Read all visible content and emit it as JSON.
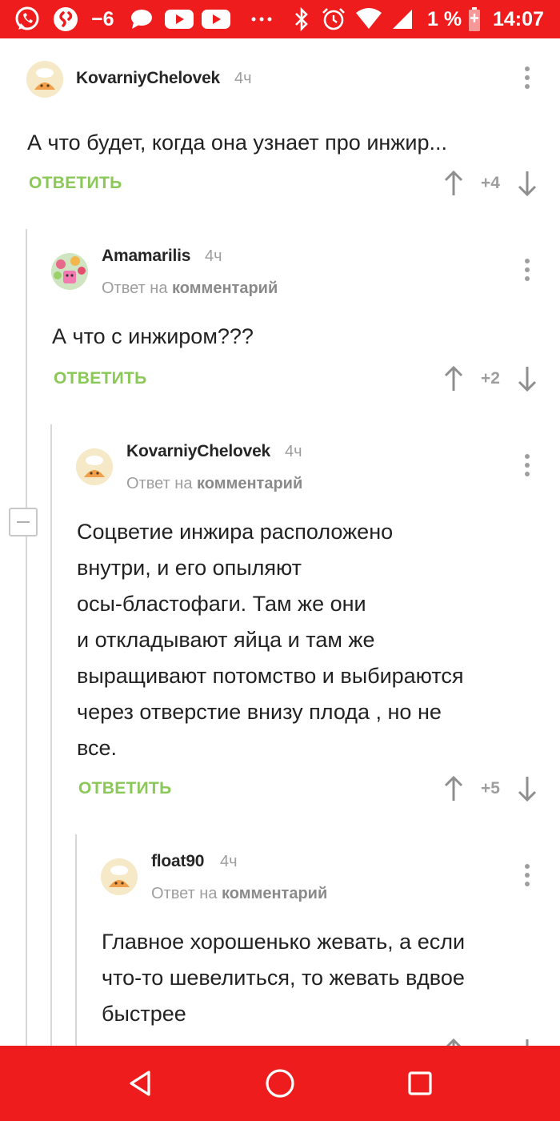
{
  "status_bar": {
    "temperature": "−6",
    "battery": "1 %",
    "time": "14:07",
    "icons": [
      "whatsapp-icon",
      "shazam-icon",
      "message-icon",
      "youtube-icon",
      "youtube-icon",
      "more-notifications-icon",
      "bluetooth-icon",
      "alarm-icon",
      "wifi-icon",
      "signal-icon",
      "battery-charging-icon"
    ]
  },
  "reply_label": "ОТВЕТИТЬ",
  "reply_to_prefix": "Ответ на",
  "reply_to_target": "комментарий",
  "comments": [
    {
      "author": "KovarniyChelovek",
      "time": "4ч",
      "text": "А что будет, когда она узнает про инжир...",
      "score": "+4"
    },
    {
      "author": "Amamarilis",
      "time": "4ч",
      "text": "А что с инжиром???",
      "score": "+2"
    },
    {
      "author": "KovarniyChelovek",
      "time": "4ч",
      "text_lines": [
        "Соцветие инжира расположено",
        "внутри, и его опыляют",
        "осы-бластофаги. Там же они",
        "и откладывают яйца и там же",
        "выращивают потомство и выбираются",
        "через отверстие внизу плода , но не",
        "все."
      ],
      "score": "+5"
    },
    {
      "author": "float90",
      "time": "4ч",
      "text_lines": [
        "Главное хорошенько жевать, а если",
        "что-то шевелиться, то жевать вдвое",
        "быстрее"
      ]
    }
  ],
  "colors": {
    "accent_red": "#ee1c1c",
    "reply_green": "#8ac858",
    "muted_grey": "#9e9e9e"
  },
  "nav_bar": {
    "buttons": [
      "back-icon",
      "home-icon",
      "recents-icon"
    ]
  }
}
